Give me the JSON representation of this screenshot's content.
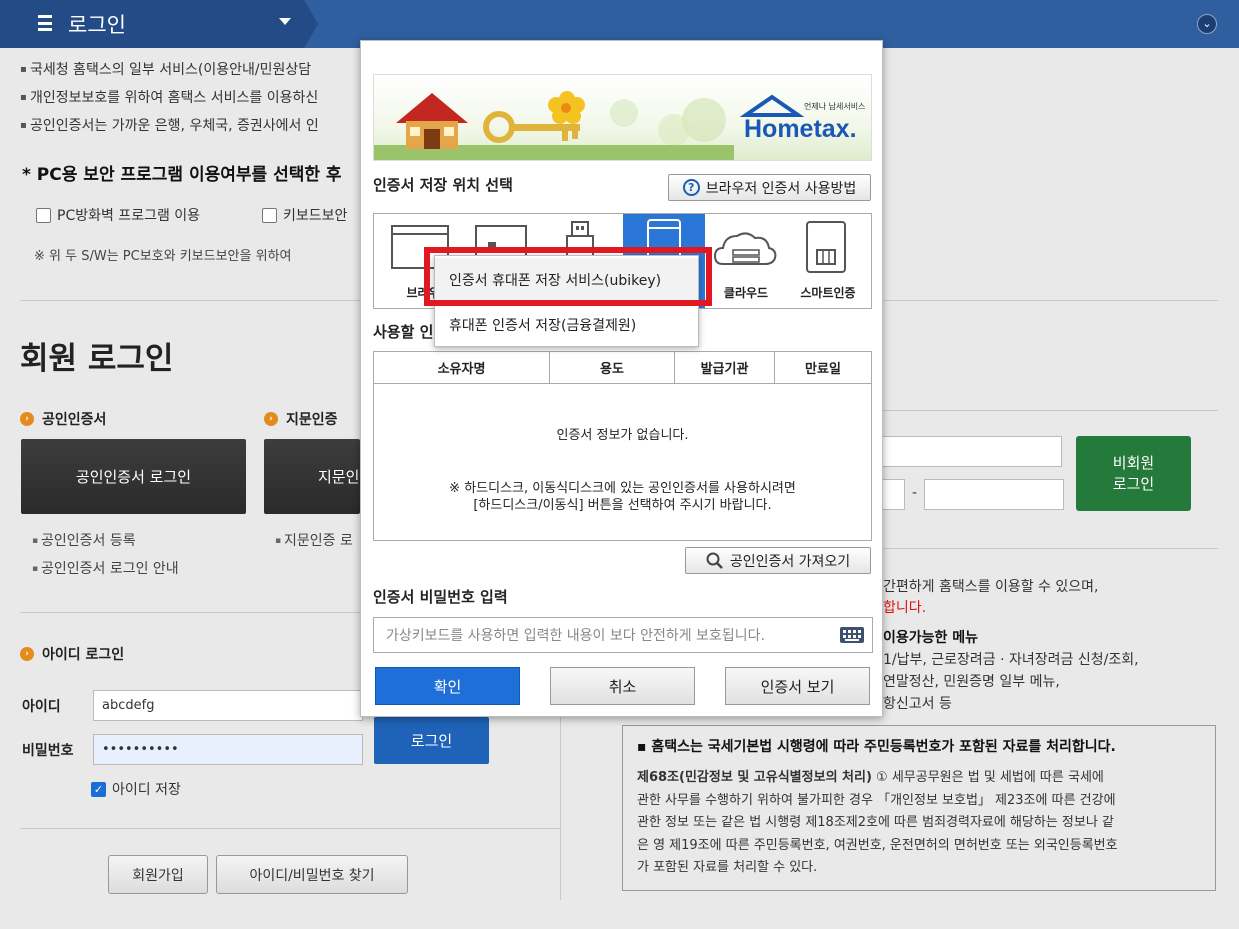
{
  "topbar": {
    "title": "로그인",
    "menu_icon": "hamburger-icon",
    "expand_icon": "chevron-down-icon"
  },
  "intro": {
    "line1": "국세청 홈택스의 일부 서비스(이용안내/민원상담",
    "line2": "개인정보보호를 위하여 홈택스 서비스를 이용하신",
    "line3": "공인인증서는 가까운 은행, 우체국, 증권사에서 인"
  },
  "security": {
    "heading": "* PC용 보안 프로그램 이용여부를 선택한 후",
    "firewall_label": "PC방화벽 프로그램 이용",
    "keyboard_label": "키보드보안",
    "note": "※ 위 두 S/W는 PC보호와 키보드보안을 위하여"
  },
  "member": {
    "title": "회원 로그인",
    "cert_section": "공인인증서",
    "finger_section": "지문인증",
    "cert_login_button": "공인인증서 로그인",
    "finger_login_button": "지문인",
    "cert_register": "공인인증서 등록",
    "cert_guide": "공인인증서 로그인 안내",
    "finger_register": "지문인증 로"
  },
  "id_login": {
    "section": "아이디 로그인",
    "id_label": "아이디",
    "id_value": "abcdefg",
    "pw_label": "비밀번호",
    "pw_value": "••••••••••",
    "login_button": "로그인",
    "save_id_label": "아이디 저장",
    "save_id_checked": true,
    "signup_button": "회원가입",
    "find_button": "아이디/비밀번호 찾기"
  },
  "nonmember": {
    "button_line1": "비회원",
    "button_line2": "로그인",
    "text1": "간편하게 홈택스를 이용할 수 있으며,",
    "text2_red": "합니다.",
    "menu_head": "이용가능한 메뉴",
    "menu1": "1/납부, 근로장려금 · 자녀장려금 신청/조회,",
    "menu2": "연말정산, 민원증명 일부 메뉴,",
    "menu3": "항신고서 등",
    "dash": "-"
  },
  "notice": {
    "head": "▪ 홈택스는 국세기본법 시행령에 따라 주민등록번호가 포함된 자료를 처리합니다.",
    "article_title": "제68조(민감정보 및 고유식별정보의 처리)",
    "line1": " ① 세무공무원은 법 및 세법에 따른 국세에",
    "line2": "관한 사무를 수행하기 위하여 불가피한 경우 「개인정보 보호법」 제23조에 따른 건강에",
    "line3": "관한 정보 또는 같은 법 시행령 제18조제2호에 따른 범죄경력자료에 해당하는 정보나 같",
    "line4": "은 영 제19조에 따른 주민등록번호, 여권번호, 운전면허의 면허번호 또는 외국인등록번호",
    "line5": "가 포함된 자료를 처리할 수 있다."
  },
  "modal": {
    "banner_logo_small": "언제나 납세서비스",
    "banner_logo": "Hometax.",
    "location_label": "인증서 저장 위치 선택",
    "howto_button": "브라우저 인증서 사용방법",
    "locations": [
      {
        "label": "브라우",
        "icon": "browser-icon"
      },
      {
        "label": "",
        "icon": "harddisk-icon"
      },
      {
        "label": "",
        "icon": "usb-icon"
      },
      {
        "label": "",
        "icon": "mobile-phone-icon"
      },
      {
        "label": "클라우드",
        "icon": "cloud-icon"
      },
      {
        "label": "스마트인증",
        "icon": "smart-card-icon"
      }
    ],
    "use_label": "사용할 인",
    "table_headers": [
      "소유자명",
      "용도",
      "발급기관",
      "만료일"
    ],
    "no_info": "인증서 정보가 없습니다.",
    "hint_line1": "※ 하드디스크, 이동식디스크에 있는 공인인증서를 사용하시려면",
    "hint_line2": "[하드디스크/이동식] 버튼을 선택하여 주시기 바랍니다.",
    "import_button": "공인인증서 가져오기",
    "pw_label": "인증서 비밀번호 입력",
    "pw_placeholder": "가상키보드를 사용하면 입력한 내용이 보다 안전하게 보호됩니다.",
    "ok_button": "확인",
    "cancel_button": "취소",
    "view_button": "인증서 보기",
    "dropdown": [
      "인증서 휴대폰 저장 서비스(ubikey)",
      "휴대폰 인증서 저장(금융결제원)"
    ]
  },
  "colors": {
    "topbar": "#2f5f9e",
    "accent_blue": "#1f6fd8",
    "green": "#247a3a",
    "highlight_red": "#e11722"
  }
}
